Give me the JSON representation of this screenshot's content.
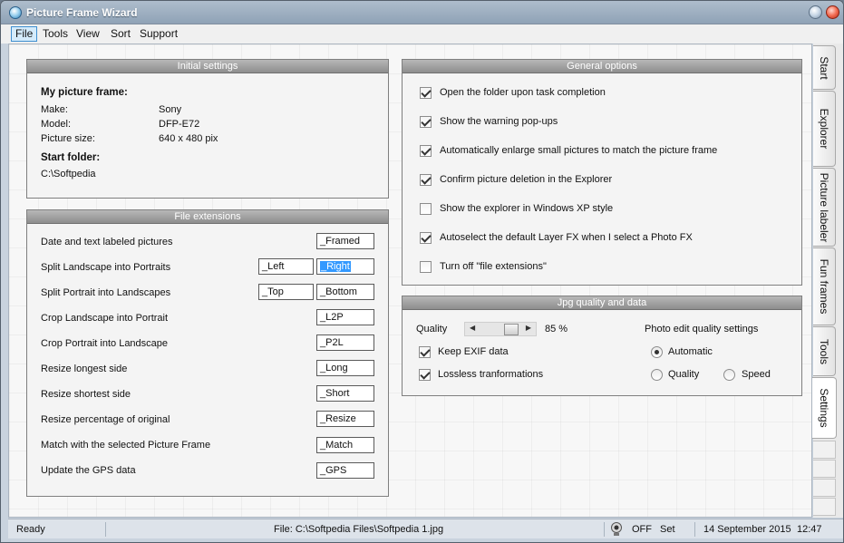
{
  "window": {
    "title": "Picture Frame Wizard"
  },
  "menu": [
    "File",
    "Tools",
    "View",
    "Sort",
    "Support"
  ],
  "side_tabs": [
    "Start",
    "Explorer",
    "Picture labeler",
    "Fun frames",
    "Tools",
    "Settings"
  ],
  "initial_settings": {
    "header": "Initial settings",
    "frame_heading": "My picture frame:",
    "make_label": "Make:",
    "make_value": "Sony",
    "model_label": "Model:",
    "model_value": "DFP-E72",
    "size_label": "Picture size:",
    "size_value": "640 x 480 pix",
    "folder_heading": "Start folder:",
    "folder_value": "C:\\Softpedia"
  },
  "file_extensions": {
    "header": "File extensions",
    "rows": [
      {
        "label": "Date and text labeled pictures",
        "value": "_Framed"
      },
      {
        "label": "Split Landscape into Portraits",
        "value2": "_Left",
        "value": "_Right"
      },
      {
        "label": "Split Portrait into Landscapes",
        "value2": "_Top",
        "value": "_Bottom"
      },
      {
        "label": "Crop Landscape into Portrait",
        "value": "_L2P"
      },
      {
        "label": "Crop Portrait into Landscape",
        "value": "_P2L"
      },
      {
        "label": "Resize longest side",
        "value": "_Long"
      },
      {
        "label": "Resize shortest side",
        "value": "_Short"
      },
      {
        "label": "Resize percentage of original",
        "value": "_Resize"
      },
      {
        "label": "Match with the selected Picture Frame",
        "value": "_Match"
      },
      {
        "label": "Update the GPS data",
        "value": "_GPS"
      }
    ]
  },
  "general_options": {
    "header": "General options",
    "options": [
      {
        "label": "Open the folder upon task completion",
        "checked": true
      },
      {
        "label": "Show the warning pop-ups",
        "checked": true
      },
      {
        "label": "Automatically enlarge small pictures to match the picture frame",
        "checked": true
      },
      {
        "label": "Confirm picture deletion in the Explorer",
        "checked": true
      },
      {
        "label": "Show the explorer in Windows XP style",
        "checked": false
      },
      {
        "label": "Autoselect the default Layer FX when I select a Photo FX",
        "checked": true
      },
      {
        "label": "Turn off \"file extensions\"",
        "checked": false
      }
    ]
  },
  "jpg": {
    "header": "Jpg quality and data",
    "quality_label": "Quality",
    "quality_value": "85 %",
    "quality_level": 85,
    "keep_exif": "Keep EXIF data",
    "lossless": "Lossless tranformations",
    "photo_edit_label": "Photo edit quality settings",
    "radio_automatic": "Automatic",
    "radio_quality": "Quality",
    "radio_speed": "Speed"
  },
  "status": {
    "ready": "Ready",
    "file": "File: C:\\Softpedia Files\\Softpedia 1.jpg",
    "webcam": "OFF",
    "set": "Set",
    "date": "14 September 2015",
    "time": "12:47"
  },
  "colors": {
    "menu_active_bg": "#d4ebfb",
    "panel_header": "#9e9e9e",
    "selection": "#3399ff"
  },
  "icons": {
    "app": "app-globe-icon",
    "minimize": "minimize-icon",
    "close": "close-icon",
    "webcam": "webcam-icon"
  }
}
